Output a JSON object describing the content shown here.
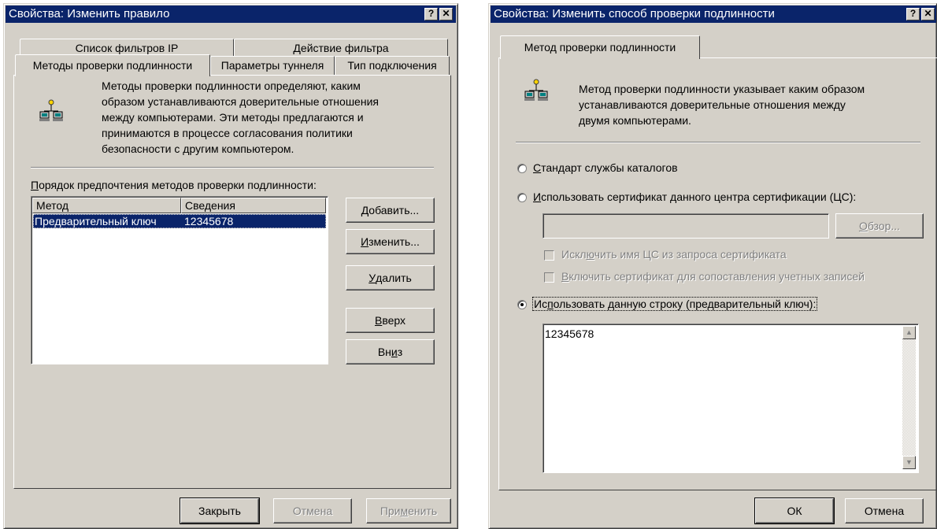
{
  "left_dialog": {
    "title": "Свойства: Изменить правило",
    "help_btn": "?",
    "close_btn": "✕",
    "tabs_row1": [
      "Список фильтров IP",
      "Действие фильтра"
    ],
    "tabs_row2": [
      "Методы проверки подлинности",
      "Параметры туннеля",
      "Тип подключения"
    ],
    "description": [
      "Методы проверки подлинности определяют, каким",
      "образом устанавливаются доверительные отношения",
      "между компьютерами. Эти методы предлагаются и",
      "принимаются в процессе согласования политики",
      "безопасности с другим компьютером."
    ],
    "order_label_ul": "П",
    "order_label_rest": "орядок предпочтения методов проверки подлинности:",
    "list_headers": [
      "Метод",
      "Сведения"
    ],
    "list_rows": [
      {
        "method": "Предварительный ключ",
        "info": "12345678"
      }
    ],
    "buttons": {
      "add_ul": "Д",
      "add_rest": "обавить...",
      "edit_ul": "И",
      "edit_rest": "зменить...",
      "delete_ul": "У",
      "delete_rest": "далить",
      "up_ul": "В",
      "up_rest": "верх",
      "down_pre": "Вн",
      "down_ul": "и",
      "down_post": "з"
    },
    "footer": {
      "close": "Закрыть",
      "cancel": "Отмена",
      "apply_pre": "При",
      "apply_ul": "м",
      "apply_post": "енить"
    }
  },
  "right_dialog": {
    "title": "Свойства: Изменить способ проверки подлинности",
    "help_btn": "?",
    "close_btn": "✕",
    "tab": "Метод проверки подлинности",
    "description": [
      "Метод проверки подлинности указывает каким образом",
      "устанавливаются доверительные отношения между",
      "двумя компьютерами."
    ],
    "option_directory_ul": "С",
    "option_directory_rest": "тандарт службы каталогов",
    "option_cert_ul": "И",
    "option_cert_rest": "спользовать сертификат данного центра сертификации (ЦС):",
    "browse_ul": "О",
    "browse_rest": "бзор...",
    "exclude_pre": "Искл",
    "exclude_ul": "ю",
    "exclude_post": "чить имя ЦС из запроса сертификата",
    "include_ul": "В",
    "include_rest": "ключить сертификат для сопоставления учетных записей",
    "option_key_pre": "Ис",
    "option_key_ul": "п",
    "option_key_post": "ользовать данную строку (предварительный ключ):",
    "key_value": "12345678",
    "ok": "ОК",
    "cancel": "Отмена"
  }
}
